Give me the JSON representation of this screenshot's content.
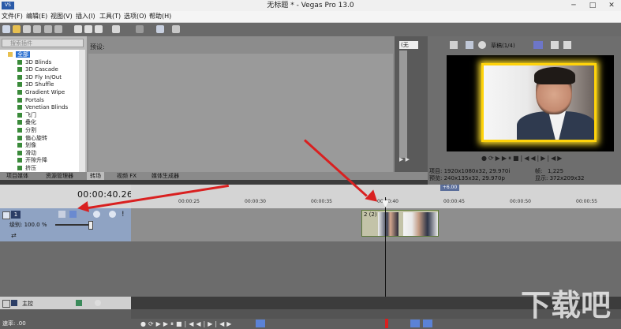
{
  "window": {
    "title": "无标题 * - Vegas Pro 13.0",
    "app_icon": "vegas-app-icon",
    "controls": [
      "minimize",
      "maximize",
      "close"
    ]
  },
  "menu": [
    "文件(F)",
    "编辑(E)",
    "视图(V)",
    "插入(I)",
    "工具(T)",
    "选项(O)",
    "帮助(H)"
  ],
  "explorer": {
    "search_placeholder": "搜索插件",
    "root": "全部",
    "items": [
      "3D Blinds",
      "3D Cascade",
      "3D Fly In/Out",
      "3D Shuffle",
      "Gradient Wipe",
      "Portals",
      "Venetian Blinds",
      "飞门",
      "叠化",
      "分割",
      "偏心旋转",
      "划像",
      "滑动",
      "开隙升降",
      "挤压"
    ]
  },
  "presets": {
    "label": "预设:"
  },
  "fx_panel": {
    "select_value": "(无"
  },
  "tabs": [
    "项目媒体",
    "资源管理器",
    "转场",
    "视频 FX",
    "媒体生成器"
  ],
  "active_tab": 2,
  "preview": {
    "quality": "草稿(1/4)",
    "project_label": "项目:",
    "project_value": "1920x1080x32, 29.970i",
    "preview_label": "预览:",
    "preview_value": "240x135x32, 29.970p",
    "frame_label": "帧:",
    "frame_value": "1,225",
    "display_label": "显示:",
    "display_value": "372x209x32"
  },
  "timeline": {
    "timecode": "00:00:40.26",
    "ruler_marker": "+6.00",
    "ruler_ticks": [
      "00:00:25",
      "00:00:30",
      "00:00:35",
      "00:00:40",
      "00:00:45",
      "00:00:50",
      "00:00:55"
    ],
    "track_number": "1",
    "track_level": "级别: 100.0 %",
    "clip_label": "2 (2)",
    "master_label": "主控",
    "rate_label": "速率: .00"
  },
  "annotation_color": "#d92020",
  "highlight_color": "#ffd30a",
  "watermark": "下载吧"
}
